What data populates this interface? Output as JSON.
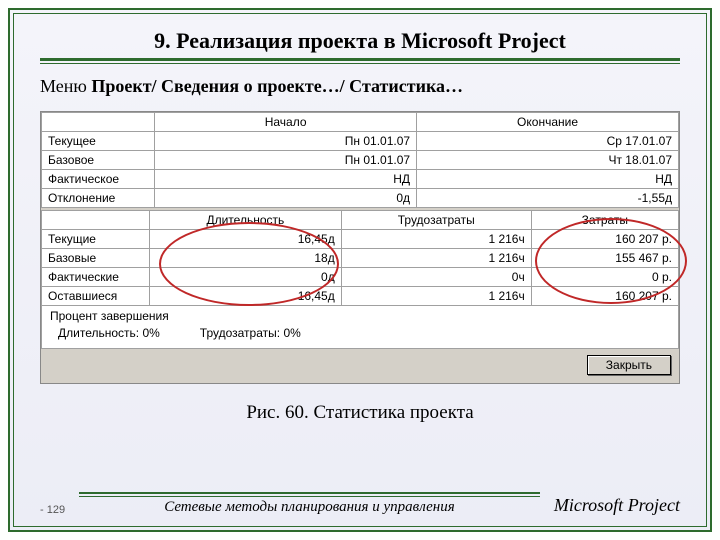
{
  "title": "9. Реализация проекта в Microsoft Project",
  "subtitle_prefix": "Меню ",
  "subtitle_bold": "Проект/ Сведения о проекте…/ Статистика…",
  "table1": {
    "headers": {
      "col1": "Начало",
      "col2": "Окончание"
    },
    "rows": [
      {
        "label": "Текущее",
        "start": "Пн 01.01.07",
        "end": "Ср 17.01.07"
      },
      {
        "label": "Базовое",
        "start": "Пн 01.01.07",
        "end": "Чт 18.01.07"
      },
      {
        "label": "Фактическое",
        "start": "НД",
        "end": "НД"
      },
      {
        "label": "Отклонение",
        "start": "0д",
        "end": "-1,55д"
      }
    ]
  },
  "table2": {
    "headers": {
      "c1": "Длительность",
      "c2": "Трудозатраты",
      "c3": "Затраты"
    },
    "rows": [
      {
        "label": "Текущие",
        "dur": "16,45д",
        "work": "1 216ч",
        "cost": "160 207 р."
      },
      {
        "label": "Базовые",
        "dur": "18д",
        "work": "1 216ч",
        "cost": "155 467 р."
      },
      {
        "label": "Фактические",
        "dur": "0д",
        "work": "0ч",
        "cost": "0 р."
      },
      {
        "label": "Оставшиеся",
        "dur": "16,45д",
        "work": "1 216ч",
        "cost": "160 207 р."
      }
    ]
  },
  "completion": {
    "title": "Процент завершения",
    "dur_label": "Длительность:",
    "dur_value": "0%",
    "work_label": "Трудозатраты:",
    "work_value": "0%"
  },
  "close_btn": "Закрыть",
  "caption": "Рис. 60. Статистика проекта",
  "page": "- 129",
  "footer_mid": "Сетевые методы планирования и управления",
  "brand": "Microsoft Project"
}
